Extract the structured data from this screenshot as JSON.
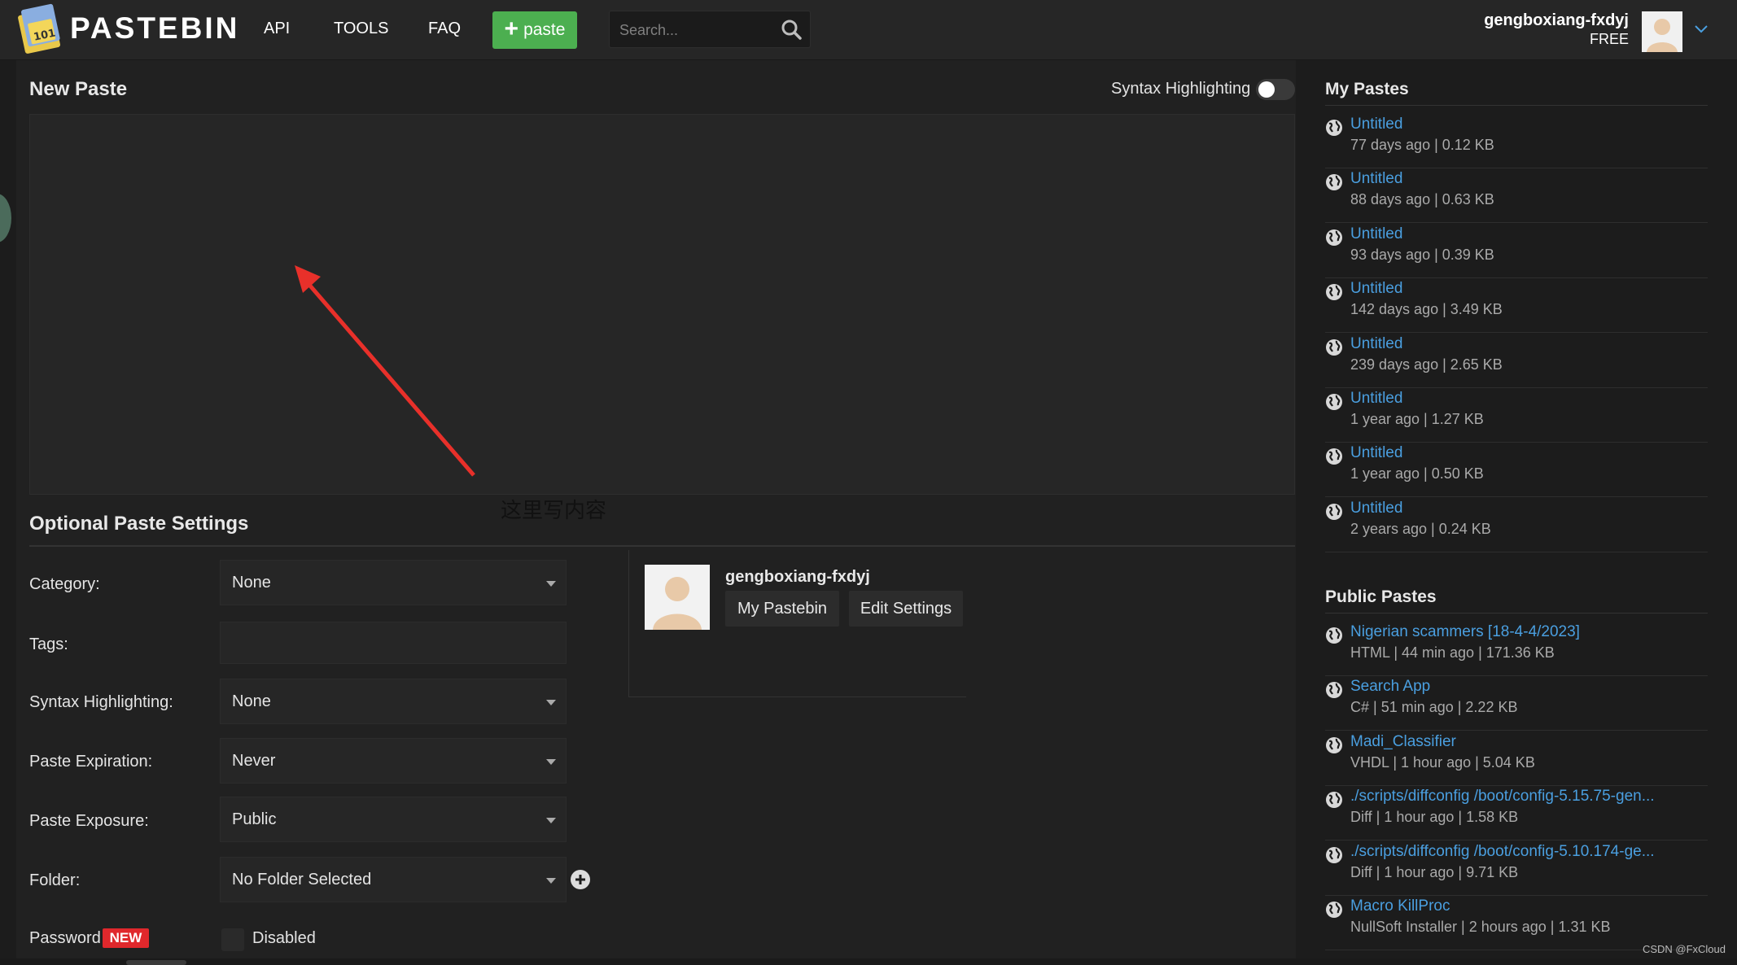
{
  "header": {
    "brand": "PASTEBIN",
    "nav": [
      {
        "label": "API"
      },
      {
        "label": "TOOLS"
      },
      {
        "label": "FAQ"
      }
    ],
    "paste_button": "paste",
    "search_placeholder": "Search...",
    "user_name": "gengboxiang-fxdyj",
    "user_plan": "FREE"
  },
  "editor": {
    "title": "New Paste",
    "syntax_toggle_label": "Syntax Highlighting",
    "syntax_toggle_on": false
  },
  "annotation": "这里写内容",
  "settings": {
    "title": "Optional Paste Settings",
    "category_label": "Category:",
    "category_value": "None",
    "tags_label": "Tags:",
    "syntax_label": "Syntax Highlighting:",
    "syntax_value": "None",
    "expiration_label": "Paste Expiration:",
    "expiration_value": "Never",
    "exposure_label": "Paste Exposure:",
    "exposure_value": "Public",
    "folder_label": "Folder:",
    "folder_value": "No Folder Selected",
    "password_label": "Password",
    "password_badge": "NEW",
    "password_value": "Disabled"
  },
  "user_card": {
    "name": "gengboxiang-fxdyj",
    "my_pastebin": "My Pastebin",
    "edit_settings": "Edit Settings"
  },
  "my_pastes": {
    "title": "My Pastes",
    "items": [
      {
        "title": "Untitled",
        "meta": "77 days ago | 0.12 KB"
      },
      {
        "title": "Untitled",
        "meta": "88 days ago | 0.63 KB"
      },
      {
        "title": "Untitled",
        "meta": "93 days ago | 0.39 KB"
      },
      {
        "title": "Untitled",
        "meta": "142 days ago | 3.49 KB"
      },
      {
        "title": "Untitled",
        "meta": "239 days ago | 2.65 KB"
      },
      {
        "title": "Untitled",
        "meta": "1 year ago | 1.27 KB"
      },
      {
        "title": "Untitled",
        "meta": "1 year ago | 0.50 KB"
      },
      {
        "title": "Untitled",
        "meta": "2 years ago | 0.24 KB"
      }
    ]
  },
  "public_pastes": {
    "title": "Public Pastes",
    "items": [
      {
        "title": "Nigerian scammers [18-4-4/2023]",
        "meta": "HTML | 44 min ago | 171.36 KB"
      },
      {
        "title": "Search App",
        "meta": "C# | 51 min ago | 2.22 KB"
      },
      {
        "title": "Madi_Classifier",
        "meta": "VHDL | 1 hour ago | 5.04 KB"
      },
      {
        "title": "./scripts/diffconfig /boot/config-5.15.75-gen...",
        "meta": "Diff | 1 hour ago | 1.58 KB"
      },
      {
        "title": "./scripts/diffconfig /boot/config-5.10.174-ge...",
        "meta": "Diff | 1 hour ago | 9.71 KB"
      },
      {
        "title": "Macro KillProc",
        "meta": "NullSoft Installer | 2 hours ago | 1.31 KB"
      }
    ]
  },
  "watermark": "CSDN @FxCloud",
  "colors": {
    "accent_green": "#4caf50",
    "link_blue": "#4a9fe0",
    "badge_red": "#e0282c",
    "arrow_red": "#e8302a"
  }
}
